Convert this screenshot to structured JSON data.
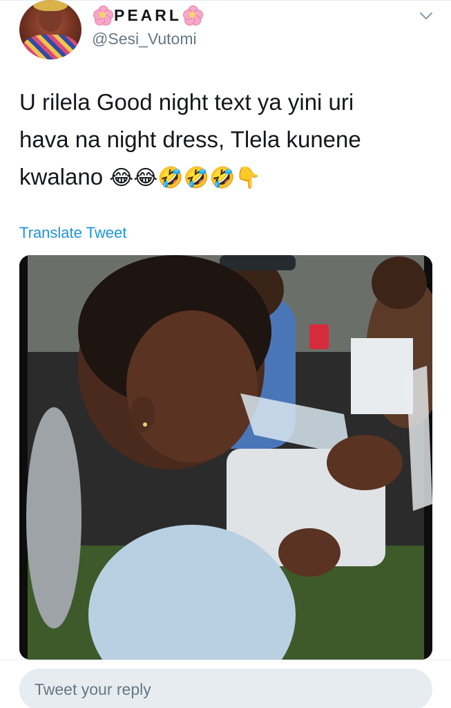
{
  "user": {
    "display_name": "PEARL",
    "handle": "@Sesi_Vutomi",
    "name_decoration_icon": "cherry-blossom-icon"
  },
  "tweet": {
    "line1": "U rilela Good night text ya yini uri",
    "line2": "hava na night dress, Tlela kunene",
    "line3": "kwalano",
    "emojis": "😂😂🤣🤣🤣👇"
  },
  "translate_label": "Translate Tweet",
  "media": {
    "icon": "photo"
  },
  "reply": {
    "placeholder": "Tweet your reply"
  },
  "colors": {
    "link": "#1b95e0",
    "secondary_text": "#657786",
    "divider": "#e6ecf0",
    "reply_bg": "#e6ecf0"
  }
}
